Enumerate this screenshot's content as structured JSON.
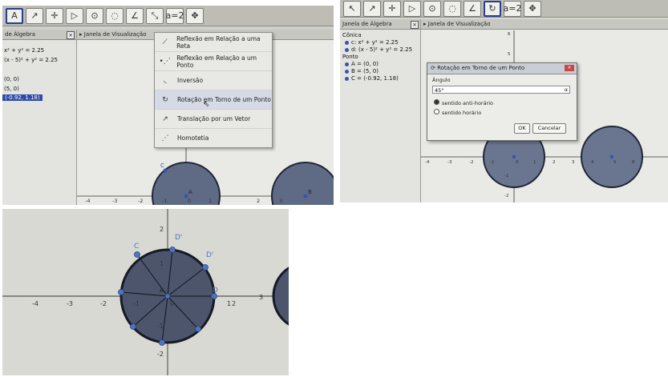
{
  "panel1": {
    "toolbar_tools": [
      "A",
      "↗",
      "✛",
      "▷",
      "⊙",
      "◌",
      "∠",
      "⤡",
      "a=2",
      "✥"
    ],
    "algebra_lines": [
      "x² + y² = 2.25",
      "(x - 5)² + y² = 2.25",
      "(0, 0)",
      "(5, 0)",
      "(-0.92, 1.18)"
    ],
    "algebra_header": "de Álgebra",
    "graphics_header": "Janela de Visualização",
    "menu_items": [
      "Reflexão em Relação a uma Reta",
      "Reflexão em Relação a um Ponto",
      "Inversão",
      "Rotação em Torno de um Ponto",
      "Translação por um Vetor",
      "Homotetia"
    ],
    "axis_labels": [
      "-4",
      "-3",
      "-2",
      "-1",
      "0",
      "1",
      "2",
      "3"
    ],
    "point_labels": [
      "C",
      "A",
      "B"
    ]
  },
  "panel2": {
    "algebra_header": "Janela de Álgebra",
    "graphics_header": "Janela de Visualização",
    "conic_header": "Cônica",
    "conic_lines": [
      "c: x² + y² = 2.25",
      "d: (x - 5)² + y² = 2.25"
    ],
    "point_header": "Ponto",
    "point_lines": [
      "A = (0, 0)",
      "B = (5, 0)",
      "C = (-0.92, 1.18)"
    ],
    "dialog": {
      "title": "Rotação em Torno de um Ponto",
      "angle_label": "Ângulo",
      "angle_value": "45°",
      "option_ccw": "sentido anti-horário",
      "option_cw": "sentido horário",
      "ok_label": "OK",
      "cancel_label": "Cancelar"
    },
    "axis_labels_x": [
      "-4",
      "-3",
      "-2",
      "-1",
      "0",
      "1",
      "2",
      "3",
      "4",
      "5",
      "6"
    ],
    "axis_labels_y": [
      "6",
      "5",
      "4",
      "3",
      "2",
      "1",
      "-1",
      "-2",
      "-3"
    ]
  },
  "panel3": {
    "axis_labels_x": [
      "-4",
      "-3",
      "-2",
      "-1",
      "0",
      "1",
      "2",
      "3"
    ],
    "axis_labels_y": [
      "2",
      "1",
      "-1",
      "-2"
    ],
    "point_labels": [
      "C",
      "D'",
      "D'",
      "D",
      "A"
    ]
  }
}
